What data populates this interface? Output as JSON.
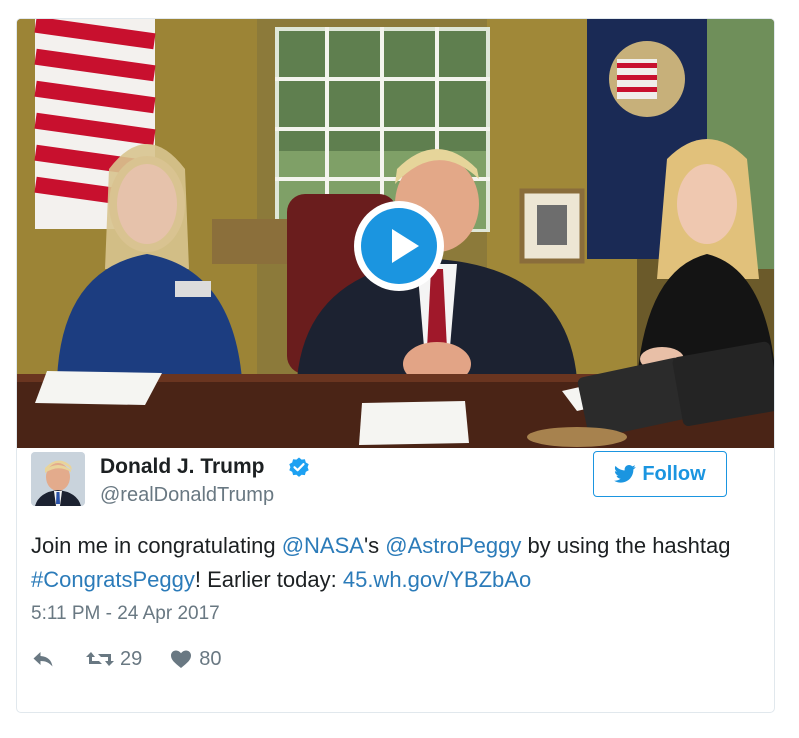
{
  "media": {
    "play_icon": "play-icon",
    "scene": "video-thumbnail"
  },
  "author": {
    "name": "Donald J. Trump",
    "handle": "@realDonaldTrump",
    "verified_icon": "verified-badge-icon"
  },
  "follow": {
    "label": "Follow",
    "icon": "twitter-bird-icon",
    "color": "#1b95e0"
  },
  "tweet": {
    "segments": [
      {
        "text": "Join me in congratulating ",
        "link": false
      },
      {
        "text": "@NASA",
        "link": true
      },
      {
        "text": "'s ",
        "link": false
      },
      {
        "text": "@AstroPeggy",
        "link": true
      },
      {
        "text": " by using the hashtag ",
        "link": false
      },
      {
        "text": "#CongratsPeggy",
        "link": true
      },
      {
        "text": "! Earlier today: ",
        "link": false
      },
      {
        "text": "45.wh.gov/YBZbAo",
        "link": true
      }
    ],
    "timestamp": "5:11 PM - 24 Apr 2017"
  },
  "actions": {
    "reply_icon": "reply-icon",
    "retweet_icon": "retweet-icon",
    "retweet_count": "29",
    "like_icon": "heart-icon",
    "like_count": "80"
  },
  "colors": {
    "link": "#2b7bb9",
    "secondary_text": "#697882",
    "primary_text": "#1c2022"
  }
}
